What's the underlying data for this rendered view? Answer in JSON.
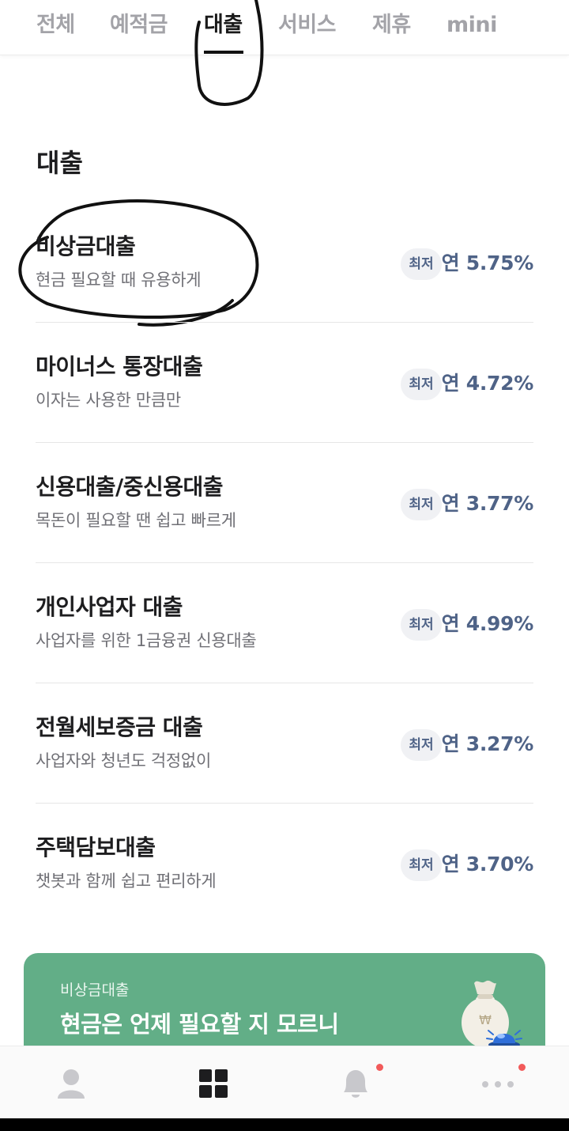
{
  "tabs": [
    {
      "label": "전체",
      "active": false
    },
    {
      "label": "예적금",
      "active": false
    },
    {
      "label": "대출",
      "active": true
    },
    {
      "label": "서비스",
      "active": false
    },
    {
      "label": "제휴",
      "active": false
    },
    {
      "label": "mini",
      "active": false
    }
  ],
  "section": {
    "title": "대출"
  },
  "loans": [
    {
      "name": "비상금대출",
      "desc": "현금 필요할 때 유용하게",
      "badge": "최저",
      "rate": "연 5.75%"
    },
    {
      "name": "마이너스 통장대출",
      "desc": "이자는 사용한 만큼만",
      "badge": "최저",
      "rate": "연 4.72%"
    },
    {
      "name": "신용대출/중신용대출",
      "desc": "목돈이 필요할 땐 쉽고 빠르게",
      "badge": "최저",
      "rate": "연 3.77%"
    },
    {
      "name": "개인사업자 대출",
      "desc": "사업자를 위한 1금융권 신용대출",
      "badge": "최저",
      "rate": "연 4.99%"
    },
    {
      "name": "전월세보증금 대출",
      "desc": "사업자와 청년도 걱정없이",
      "badge": "최저",
      "rate": "연 3.27%"
    },
    {
      "name": "주택담보대출",
      "desc": "챗봇과 함께 쉽고 편리하게",
      "badge": "최저",
      "rate": "연 3.70%"
    }
  ],
  "promo": {
    "kicker": "비상금대출",
    "title": "현금은 언제 필요할 지 모르니",
    "icon": "money-bag-icon",
    "coin_symbol": "₩"
  },
  "bottom_nav": [
    {
      "name": "profile-icon",
      "badge": false
    },
    {
      "name": "grid-icon",
      "badge": false
    },
    {
      "name": "bell-icon",
      "badge": true
    },
    {
      "name": "more-icon",
      "badge": true
    }
  ],
  "colors": {
    "accent": "#4f6387",
    "promo_bg": "#62ae87",
    "badge_dot": "#f25a5a",
    "icon_gray": "#c8c8cc"
  }
}
